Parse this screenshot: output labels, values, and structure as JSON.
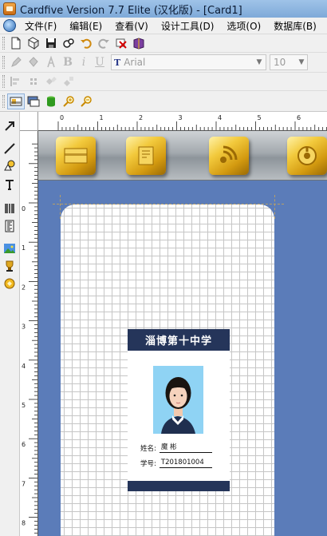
{
  "window": {
    "title": "Cardfive Version 7.7 Elite (汉化版) - [Card1]"
  },
  "menu": [
    {
      "label": "文件(F)"
    },
    {
      "label": "编辑(E)"
    },
    {
      "label": "查看(V)"
    },
    {
      "label": "设计工具(D)"
    },
    {
      "label": "选项(O)"
    },
    {
      "label": "数据库(B)"
    }
  ],
  "font_toolbar": {
    "font_name": "Arial",
    "font_size": "10",
    "bold": "B",
    "italic": "i",
    "underline": "U"
  },
  "hruler_labels": [
    "0",
    "1",
    "2",
    "3",
    "4",
    "5",
    "6"
  ],
  "vruler_labels": [
    "0",
    "1",
    "2",
    "3",
    "4",
    "5",
    "6",
    "7",
    "8"
  ],
  "card": {
    "school_name": "淄博第十中学",
    "name_label": "姓名:",
    "name_value": "魔 彬",
    "id_label": "学号:",
    "id_value": "T201801004"
  },
  "colors": {
    "card_header": "#25355a",
    "canvas_bg": "#5b7cb9",
    "gold_button": "#e0b021"
  },
  "icons": {
    "metal_buttons": [
      "card-icon",
      "template-icon",
      "signal-icon",
      "disc-icon"
    ]
  }
}
